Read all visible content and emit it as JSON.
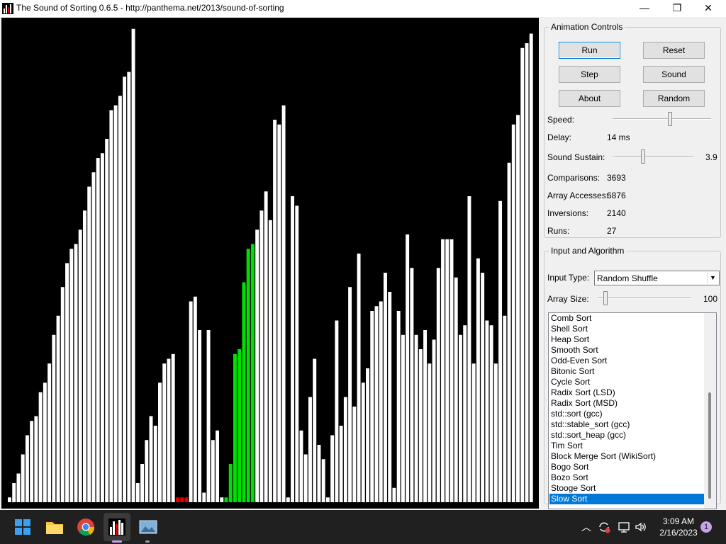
{
  "window": {
    "title": "The Sound of Sorting 0.6.5 - http://panthema.net/2013/sound-of-sorting",
    "minimize_glyph": "—",
    "maximize_glyph": "❐",
    "close_glyph": "✕"
  },
  "visualization": {
    "array_values": [
      1,
      4,
      6,
      10,
      14,
      17,
      18,
      23,
      25,
      29,
      35,
      39,
      45,
      50,
      53,
      54,
      57,
      61,
      66,
      69,
      72,
      73,
      76,
      82,
      83,
      85,
      89,
      90,
      99,
      4,
      8,
      13,
      18,
      16,
      25,
      29,
      30,
      31,
      1,
      1,
      1,
      42,
      43,
      36,
      2,
      36,
      13,
      15,
      1,
      1,
      8,
      31,
      32,
      46,
      53,
      54,
      57,
      61,
      65,
      59,
      80,
      79,
      83,
      1,
      64,
      62,
      15,
      10,
      22,
      30,
      12,
      9,
      1,
      14,
      38,
      16,
      22,
      45,
      20,
      52,
      25,
      28,
      40,
      41,
      42,
      48,
      44,
      3,
      40,
      35,
      56,
      49,
      35,
      32,
      36,
      29,
      34,
      49,
      55,
      55,
      55,
      47,
      35,
      37,
      64,
      29,
      51,
      48,
      38,
      37,
      29,
      63,
      39,
      71,
      79,
      81,
      95,
      96,
      98
    ],
    "highlight_colors": {
      "white": "#ffffff",
      "green": "#00e000",
      "red": "#e00000"
    },
    "red_indices": [
      38,
      39,
      40
    ],
    "green_indices": [
      49,
      50,
      51,
      52,
      53,
      54,
      55
    ]
  },
  "animation_controls": {
    "group_title": "Animation Controls",
    "run_label": "Run",
    "reset_label": "Reset",
    "step_label": "Step",
    "sound_label": "Sound",
    "about_label": "About",
    "random_label": "Random",
    "speed_label": "Speed:",
    "speed_level": 0.58,
    "delay_label": "Delay:",
    "delay_value": "14 ms",
    "sustain_label": "Sound Sustain:",
    "sustain_value": "3.9",
    "sustain_level": 0.38,
    "comparisons_label": "Comparisons:",
    "comparisons_value": "3693",
    "accesses_label": "Array Accesses:",
    "accesses_value": "6876",
    "inversions_label": "Inversions:",
    "inversions_value": "2140",
    "runs_label": "Runs:",
    "runs_value": "27"
  },
  "input_algorithm": {
    "group_title": "Input and Algorithm",
    "input_type_label": "Input Type:",
    "input_type_value": "Random Shuffle",
    "array_size_label": "Array Size:",
    "array_size_value": "100",
    "array_size_level": 0.08,
    "algorithms": [
      "Comb Sort",
      "Shell Sort",
      "Heap Sort",
      "Smooth Sort",
      "Odd-Even Sort",
      "Bitonic Sort",
      "Cycle Sort",
      "Radix Sort (LSD)",
      "Radix Sort (MSD)",
      "std::sort (gcc)",
      "std::stable_sort (gcc)",
      "std::sort_heap (gcc)",
      "Tim Sort",
      "Block Merge Sort (WikiSort)",
      "Bogo Sort",
      "Bozo Sort",
      "Stooge Sort",
      "Slow Sort"
    ],
    "selected_algorithm": "Slow Sort"
  },
  "taskbar": {
    "time": "3:09 AM",
    "date": "2/16/2023",
    "notification_count": "1",
    "accent": "#0078d7"
  }
}
